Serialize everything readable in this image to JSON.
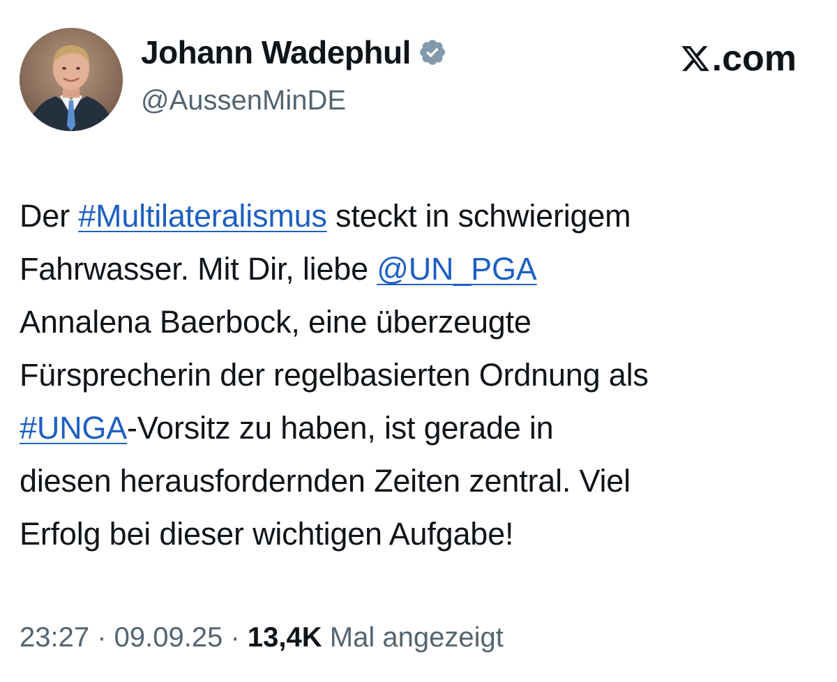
{
  "author": {
    "display_name": "Johann Wadephul",
    "handle": "@AussenMinDE",
    "verified_badge_icon": "verified-badge-icon",
    "verified_color": "#829aab"
  },
  "brand": {
    "logo_icon": "x-logo-icon",
    "domain_suffix": ".com"
  },
  "tweet": {
    "segments": {
      "l1a": "Der ",
      "l1_hashtag": "#Multilateralismus",
      "l1b": " steckt in schwierigem",
      "l2a": "Fahrwasser. Mit Dir, liebe ",
      "l2_mention": "@UN_PGA",
      "l3": "Annalena Baerbock, eine überzeugte",
      "l4": "Fürsprecherin der regelbasierten Ordnung als",
      "l5_hashtag": "#UNGA",
      "l5b": "-Vorsitz zu haben, ist gerade in",
      "l6": "diesen herausfordernden Zeiten zentral. Viel",
      "l7": "Erfolg bei dieser wichtigen Aufgabe!"
    },
    "link_color": "#1d5fc2"
  },
  "meta": {
    "time": "23:27",
    "separator": " · ",
    "date": "09.09.25",
    "views_count": "13,4K",
    "views_label": " Mal angezeigt"
  }
}
